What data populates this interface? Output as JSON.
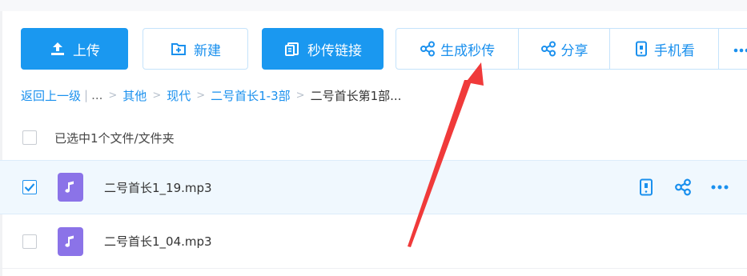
{
  "toolbar": {
    "upload_label": "上传",
    "new_label": "新建",
    "instant_link_label": "秒传链接",
    "group": {
      "generate_label": "生成秒传",
      "share_label": "分享",
      "phone_label": "手机看"
    }
  },
  "breadcrumb": {
    "back_label": "返回上一级",
    "ellipsis": "...",
    "items": [
      "其他",
      "现代",
      "二号首长1-3部"
    ],
    "current": "二号首长第1部..."
  },
  "selection": {
    "status_text": "已选中1个文件/文件夹"
  },
  "files": [
    {
      "name": "二号首长1_19.mp3",
      "checked": true
    },
    {
      "name": "二号首长1_04.mp3",
      "checked": false
    }
  ],
  "colors": {
    "accent": "#1a90ee",
    "primary_button": "#1a98f0",
    "music_icon": "#8b73e8",
    "annotation_arrow": "#f03a3a"
  }
}
